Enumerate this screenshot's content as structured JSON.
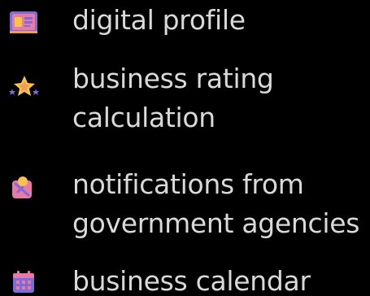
{
  "features": [
    {
      "label": "digital profile",
      "icon": "profile-card-icon"
    },
    {
      "label": "business rating calculation",
      "icon": "star-rating-icon"
    },
    {
      "label": "notifications from government agencies",
      "icon": "notification-badge-icon"
    },
    {
      "label": "business calendar",
      "icon": "calendar-icon"
    }
  ],
  "colors": {
    "background": "#000000",
    "text": "#d9d9d9",
    "icon_pink": "#e87aa8",
    "icon_purple": "#7f6bd6",
    "icon_yellow": "#f7c34a",
    "icon_orange": "#f29a5a"
  }
}
